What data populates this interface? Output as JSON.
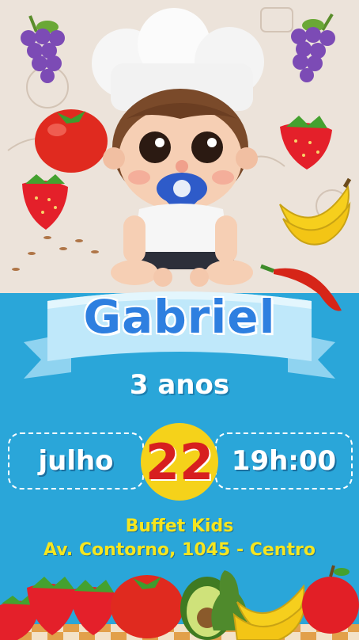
{
  "invitation": {
    "name": "Gabriel",
    "age": "3 anos",
    "month": "julho",
    "day": "22",
    "time": "19h:00",
    "venue_name": "Buffet Kids",
    "venue_address": "Av. Contorno, 1045 - Centro"
  },
  "colors": {
    "top_background": "#ece3da",
    "bottom_background": "#2aa6d9",
    "name_color": "#2e7fe0",
    "day_circle": "#f5d21a",
    "day_color": "#d71f1f",
    "venue_color": "#f5e51f"
  }
}
